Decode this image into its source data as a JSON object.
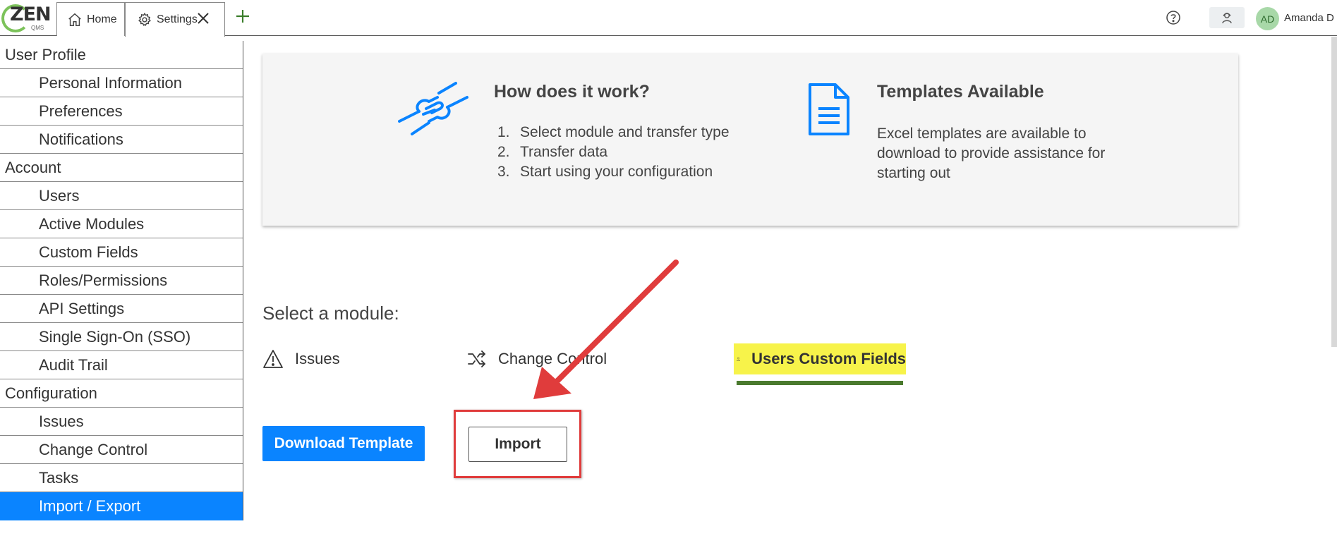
{
  "logo": {
    "text": "ZEN",
    "sub": "QMS"
  },
  "tabs": [
    {
      "label": "Home"
    },
    {
      "label": "Settings"
    }
  ],
  "user": {
    "initials": "AD",
    "name": "Amanda D"
  },
  "sidebar": {
    "items": [
      {
        "label": "User Profile",
        "type": "group"
      },
      {
        "label": "Personal Information",
        "type": "item"
      },
      {
        "label": "Preferences",
        "type": "item"
      },
      {
        "label": "Notifications",
        "type": "item"
      },
      {
        "label": "Account",
        "type": "group"
      },
      {
        "label": "Users",
        "type": "item"
      },
      {
        "label": "Active Modules",
        "type": "item"
      },
      {
        "label": "Custom Fields",
        "type": "item"
      },
      {
        "label": "Roles/Permissions",
        "type": "item"
      },
      {
        "label": "API Settings",
        "type": "item"
      },
      {
        "label": "Single Sign-On (SSO)",
        "type": "item"
      },
      {
        "label": "Audit Trail",
        "type": "item"
      },
      {
        "label": "Configuration",
        "type": "group"
      },
      {
        "label": "Issues",
        "type": "item"
      },
      {
        "label": "Change Control",
        "type": "item"
      },
      {
        "label": "Tasks",
        "type": "item"
      },
      {
        "label": "Import / Export",
        "type": "item",
        "active": true
      }
    ]
  },
  "info": {
    "how_title": "How does it work?",
    "steps": [
      {
        "num": "1.",
        "text": "Select module and transfer type"
      },
      {
        "num": "2.",
        "text": "Transfer data"
      },
      {
        "num": "3.",
        "text": "Start using your configuration"
      }
    ],
    "templates_title": "Templates Available",
    "templates_desc": "Excel templates are available to download to provide assistance for starting out"
  },
  "modules": {
    "label": "Select a module:",
    "items": [
      {
        "label": "Issues",
        "icon": "warning-icon"
      },
      {
        "label": "Change Control",
        "icon": "shuffle-icon"
      },
      {
        "label": "Users Custom Fields",
        "icon": "user-icon",
        "selected": true
      }
    ]
  },
  "actions": {
    "download_label": "Download Template",
    "import_label": "Import"
  },
  "colors": {
    "accent": "#0a84ff",
    "highlight": "#f7f34a",
    "selected_underline": "#4a7a2e",
    "annotation": "#e03c3c"
  }
}
